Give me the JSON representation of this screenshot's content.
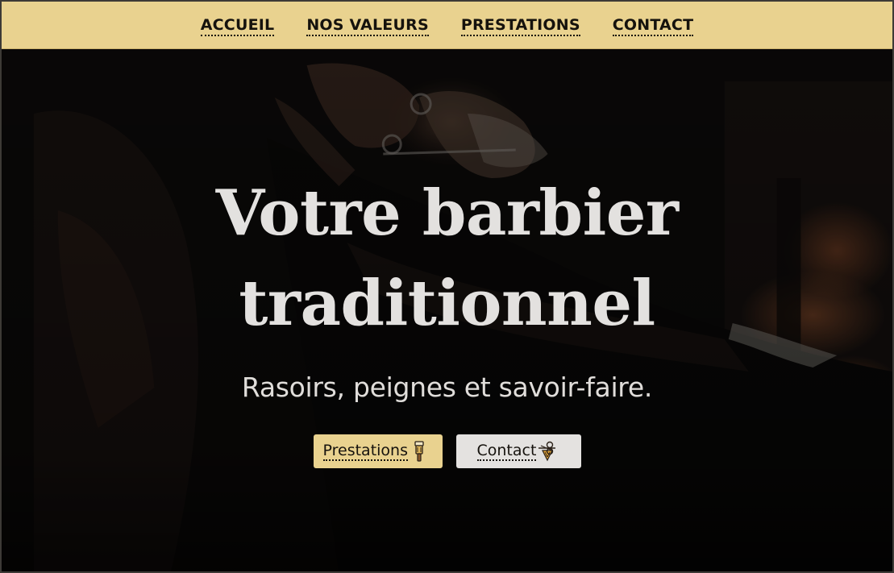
{
  "nav": {
    "items": [
      {
        "label": "ACCUEIL"
      },
      {
        "label": "NOS VALEURS"
      },
      {
        "label": "PRESTATIONS"
      },
      {
        "label": "CONTACT"
      }
    ]
  },
  "hero": {
    "title_line1": "Votre barbier",
    "title_line2": "traditionnel",
    "subtitle": "Rasoirs, peignes et savoir-faire.",
    "primary_button": {
      "label": "Prestations",
      "icon": "razor-icon"
    },
    "secondary_button": {
      "label": "Contact",
      "icon": "scissors-comb-icon"
    }
  },
  "colors": {
    "accent": "#e9d28f",
    "text_dark": "#15120d",
    "hero_text": "#e3e1df",
    "secondary_button_bg": "#e4e2e0",
    "background": "#0b0908"
  }
}
